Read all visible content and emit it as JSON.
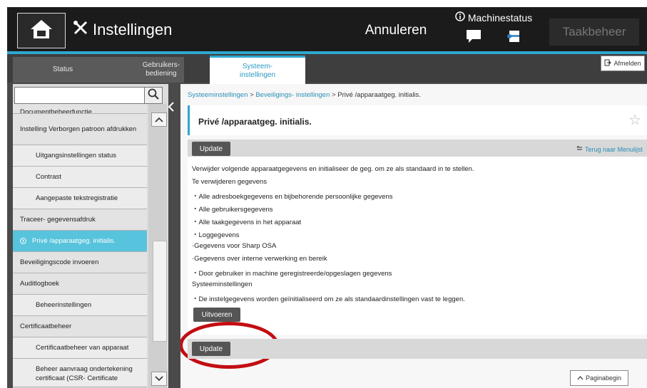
{
  "header": {
    "title": "Instellingen",
    "cancel_label": "Annuleren",
    "machine_status_label": "Machinestatus",
    "job_status_label": "Taakbeheer"
  },
  "tabs": [
    {
      "label": "Status"
    },
    {
      "label": "Gebruikers-\nbediening"
    },
    {
      "label": "Systeem-\ninstellingen"
    }
  ],
  "logout_label": "Afmelden",
  "sidebar": {
    "search_value": "",
    "items": [
      {
        "label": "Documentbeheerfunctie"
      },
      {
        "label": "Instelling Verborgen patroon afdrukken"
      },
      {
        "label": "Uitgangsinstellingen status"
      },
      {
        "label": "Contrast"
      },
      {
        "label": "Aangepaste tekstregistratie"
      },
      {
        "label": "Traceer- gegevensafdruk"
      },
      {
        "label": "Privé /apparaatgeg. initialis."
      },
      {
        "label": "Beveiligingscode invoeren"
      },
      {
        "label": "Auditlogboek"
      },
      {
        "label": "Beheerinstellingen"
      },
      {
        "label": "Certificaatbeheer"
      },
      {
        "label": "Certificaatbeheer van apparaat"
      },
      {
        "label": "Beheer aanvraag ondertekening certificaat (CSR- Certificate"
      }
    ]
  },
  "breadcrumb": {
    "item1": "Systeeminstellingen",
    "item2": "Beveiligings- instellingen",
    "current": "Privé /apparaatgeg. initialis.",
    "separator": ">"
  },
  "page": {
    "title": "Privé /apparaatgeg. initialis.",
    "update_label": "Update",
    "back_link": "Terug naar Menulijst",
    "lines": [
      "Verwijder volgende apparaatgegevens en initialiseer de geg. om ze als standaard in te stellen.",
      "Te verwijderen gegevens",
      "・Alle adresboekgegevens en bijbehorende persoonlijke gegevens",
      "・Alle gebruikersgegevens",
      "・Alle taakgegevens in het apparaat",
      "・Loggegevens",
      "·Gegevens voor Sharp OSA",
      "·Gegevens over interne verwerking en bereik",
      "・Door gebruiker in machine geregistreerde/opgeslagen gegevens",
      "Systeeminstellingen",
      "・De instelgegevens worden geïnitialiseerd om ze als standaardinstellingen vast te leggen."
    ],
    "execute_label": "Uitvoeren",
    "top_of_page_label": "Paginabegin"
  },
  "colors": {
    "accent": "#2ea8cf",
    "selected_item": "#58c3dc",
    "highlight_circle": "#c30d12"
  }
}
